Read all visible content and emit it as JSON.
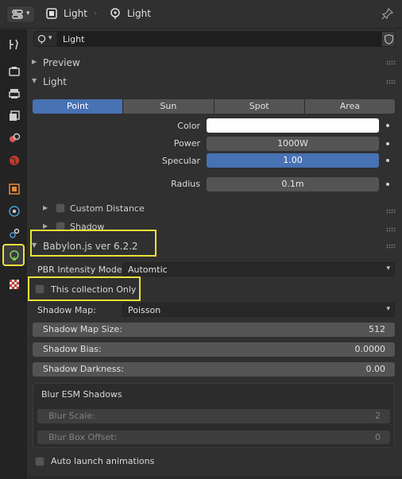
{
  "header": {
    "object_name": "Light",
    "data_name": "Light"
  },
  "datablock": {
    "name": "Light"
  },
  "panels": {
    "preview": "Preview",
    "light": "Light",
    "shadow": "Shadow",
    "babylon": "Babylon.js ver 6.2.2"
  },
  "light_types": [
    "Point",
    "Sun",
    "Spot",
    "Area"
  ],
  "light_props": {
    "color_label": "Color",
    "color_value": "#ffffff",
    "power_label": "Power",
    "power_value": "1000W",
    "specular_label": "Specular",
    "specular_value": "1.00",
    "radius_label": "Radius",
    "radius_value": "0.1m",
    "custom_distance": "Custom Distance"
  },
  "babylon": {
    "pbr_label": "PBR Intensity Mode:",
    "pbr_value": "Automtic",
    "collection_only": "This collection Only",
    "shadow_map_label": "Shadow Map:",
    "shadow_map_value": "Poisson",
    "shadow_map_size_label": "Shadow Map Size:",
    "shadow_map_size_value": "512",
    "shadow_bias_label": "Shadow Bias:",
    "shadow_bias_value": "0.0000",
    "shadow_darkness_label": "Shadow Darkness:",
    "shadow_darkness_value": "0.00",
    "blur_title": "Blur ESM Shadows",
    "blur_scale_label": "Blur Scale:",
    "blur_scale_value": "2",
    "blur_box_label": "Blur Box Offset:",
    "blur_box_value": "0",
    "auto_launch": "Auto launch animations"
  },
  "colors": {
    "accent_blue": "#4772b3",
    "highlight_yellow": "#e8e23a"
  }
}
